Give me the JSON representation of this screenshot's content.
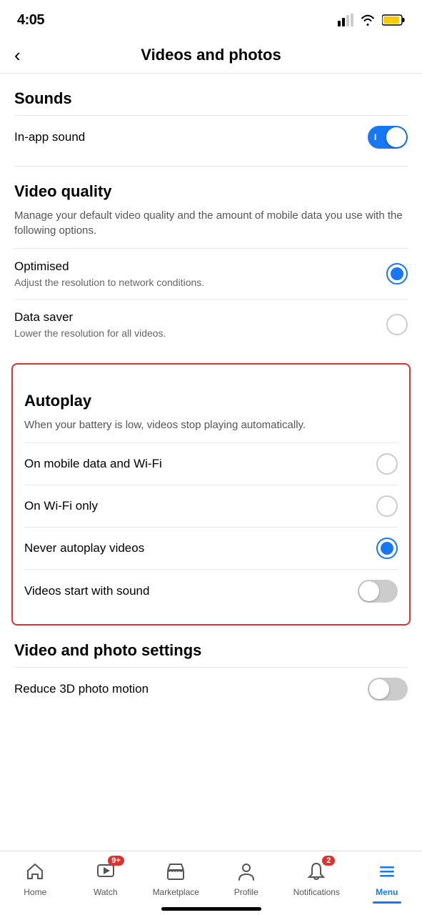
{
  "statusBar": {
    "time": "4:05"
  },
  "header": {
    "backLabel": "‹",
    "title": "Videos and photos"
  },
  "sounds": {
    "sectionTitle": "Sounds",
    "inAppSound": {
      "label": "In-app sound",
      "enabled": true
    }
  },
  "videoQuality": {
    "sectionTitle": "Video quality",
    "description": "Manage your default video quality and the amount of mobile data you use with the following options.",
    "options": [
      {
        "label": "Optimised",
        "sublabel": "Adjust the resolution to network conditions.",
        "selected": true
      },
      {
        "label": "Data saver",
        "sublabel": "Lower the resolution for all videos.",
        "selected": false
      }
    ]
  },
  "autoplay": {
    "sectionTitle": "Autoplay",
    "description": "When your battery is low, videos stop playing automatically.",
    "options": [
      {
        "label": "On mobile data and Wi-Fi",
        "selected": false
      },
      {
        "label": "On Wi-Fi only",
        "selected": false
      },
      {
        "label": "Never autoplay videos",
        "selected": true
      }
    ],
    "videosStartWithSound": {
      "label": "Videos start with sound",
      "enabled": false
    }
  },
  "videoPhotoSettings": {
    "sectionTitle": "Video and photo settings",
    "reduce3DPhotoMotion": {
      "label": "Reduce 3D photo motion",
      "enabled": false
    }
  },
  "bottomNav": {
    "items": [
      {
        "id": "home",
        "label": "Home",
        "badge": null,
        "active": false
      },
      {
        "id": "watch",
        "label": "Watch",
        "badge": "9+",
        "active": false
      },
      {
        "id": "marketplace",
        "label": "Marketplace",
        "badge": null,
        "active": false
      },
      {
        "id": "profile",
        "label": "Profile",
        "badge": null,
        "active": false
      },
      {
        "id": "notifications",
        "label": "Notifications",
        "badge": "2",
        "active": false
      },
      {
        "id": "menu",
        "label": "Menu",
        "badge": null,
        "active": true
      }
    ]
  }
}
